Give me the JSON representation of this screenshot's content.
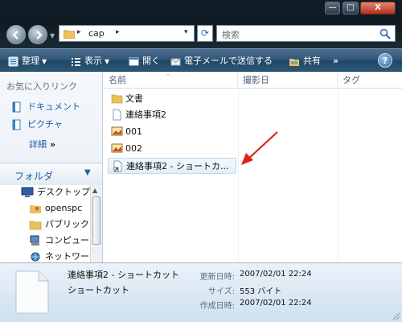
{
  "window": {
    "close_glyph": "X",
    "max_glyph": "□",
    "min_glyph": "—"
  },
  "address": {
    "path": "cap",
    "separator": "▸",
    "dropdown": "▾"
  },
  "search": {
    "placeholder": "検索"
  },
  "toolbar": {
    "organize": "整理",
    "views": "表示",
    "open": "開く",
    "email": "電子メールで送信する",
    "share": "共有",
    "more": "»",
    "help": "?"
  },
  "navpane": {
    "fav_heading": "お気に入りリンク",
    "favorites": [
      {
        "label": "ドキュメント",
        "icon": "documents-icon"
      },
      {
        "label": "ピクチャ",
        "icon": "pictures-icon"
      }
    ],
    "more_label": "詳細",
    "more_chevron": "»",
    "folders_title": "フォルダ",
    "tree": [
      {
        "label": "デスクトップ",
        "icon": "desktop-icon"
      },
      {
        "label": "openspc",
        "icon": "user-folder-icon"
      },
      {
        "label": "パブリック",
        "icon": "folder-icon"
      },
      {
        "label": "コンピュー",
        "icon": "computer-icon"
      },
      {
        "label": "ネットワー",
        "icon": "network-icon"
      }
    ]
  },
  "columns": [
    "名前",
    "撮影日",
    "タグ"
  ],
  "files": [
    {
      "name": "文書",
      "icon": "folder-icon"
    },
    {
      "name": "連絡事項2",
      "icon": "document-icon"
    },
    {
      "name": "001",
      "icon": "image-icon"
    },
    {
      "name": "002",
      "icon": "image-icon"
    },
    {
      "name": "連絡事項2 - ショートカ...",
      "icon": "shortcut-icon",
      "selected": true
    }
  ],
  "details": {
    "name": "連絡事項2 - ショートカット",
    "type": "ショートカット",
    "modified_label": "更新日時:",
    "modified": "2007/02/01 22:24",
    "size_label": "サイズ:",
    "size": "553 バイト",
    "created_label": "作成日時:",
    "created": "2007/02/01 22:24"
  },
  "colors": {
    "annotation_arrow": "#e0201a",
    "link": "#1d5aa6",
    "selection": "#e2eefa"
  }
}
